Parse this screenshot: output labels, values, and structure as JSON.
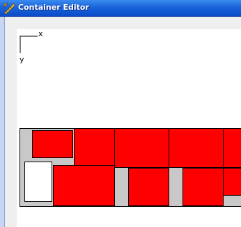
{
  "window": {
    "title": "Container Editor",
    "icon": "ruler-pencil-icon"
  },
  "axes": {
    "x_label": "x",
    "y_label": "y"
  },
  "container": {
    "background_color": "#c8c8c8",
    "box_color": "#ff0000",
    "empty_box_color": "#ffffff",
    "box_count": 11
  }
}
